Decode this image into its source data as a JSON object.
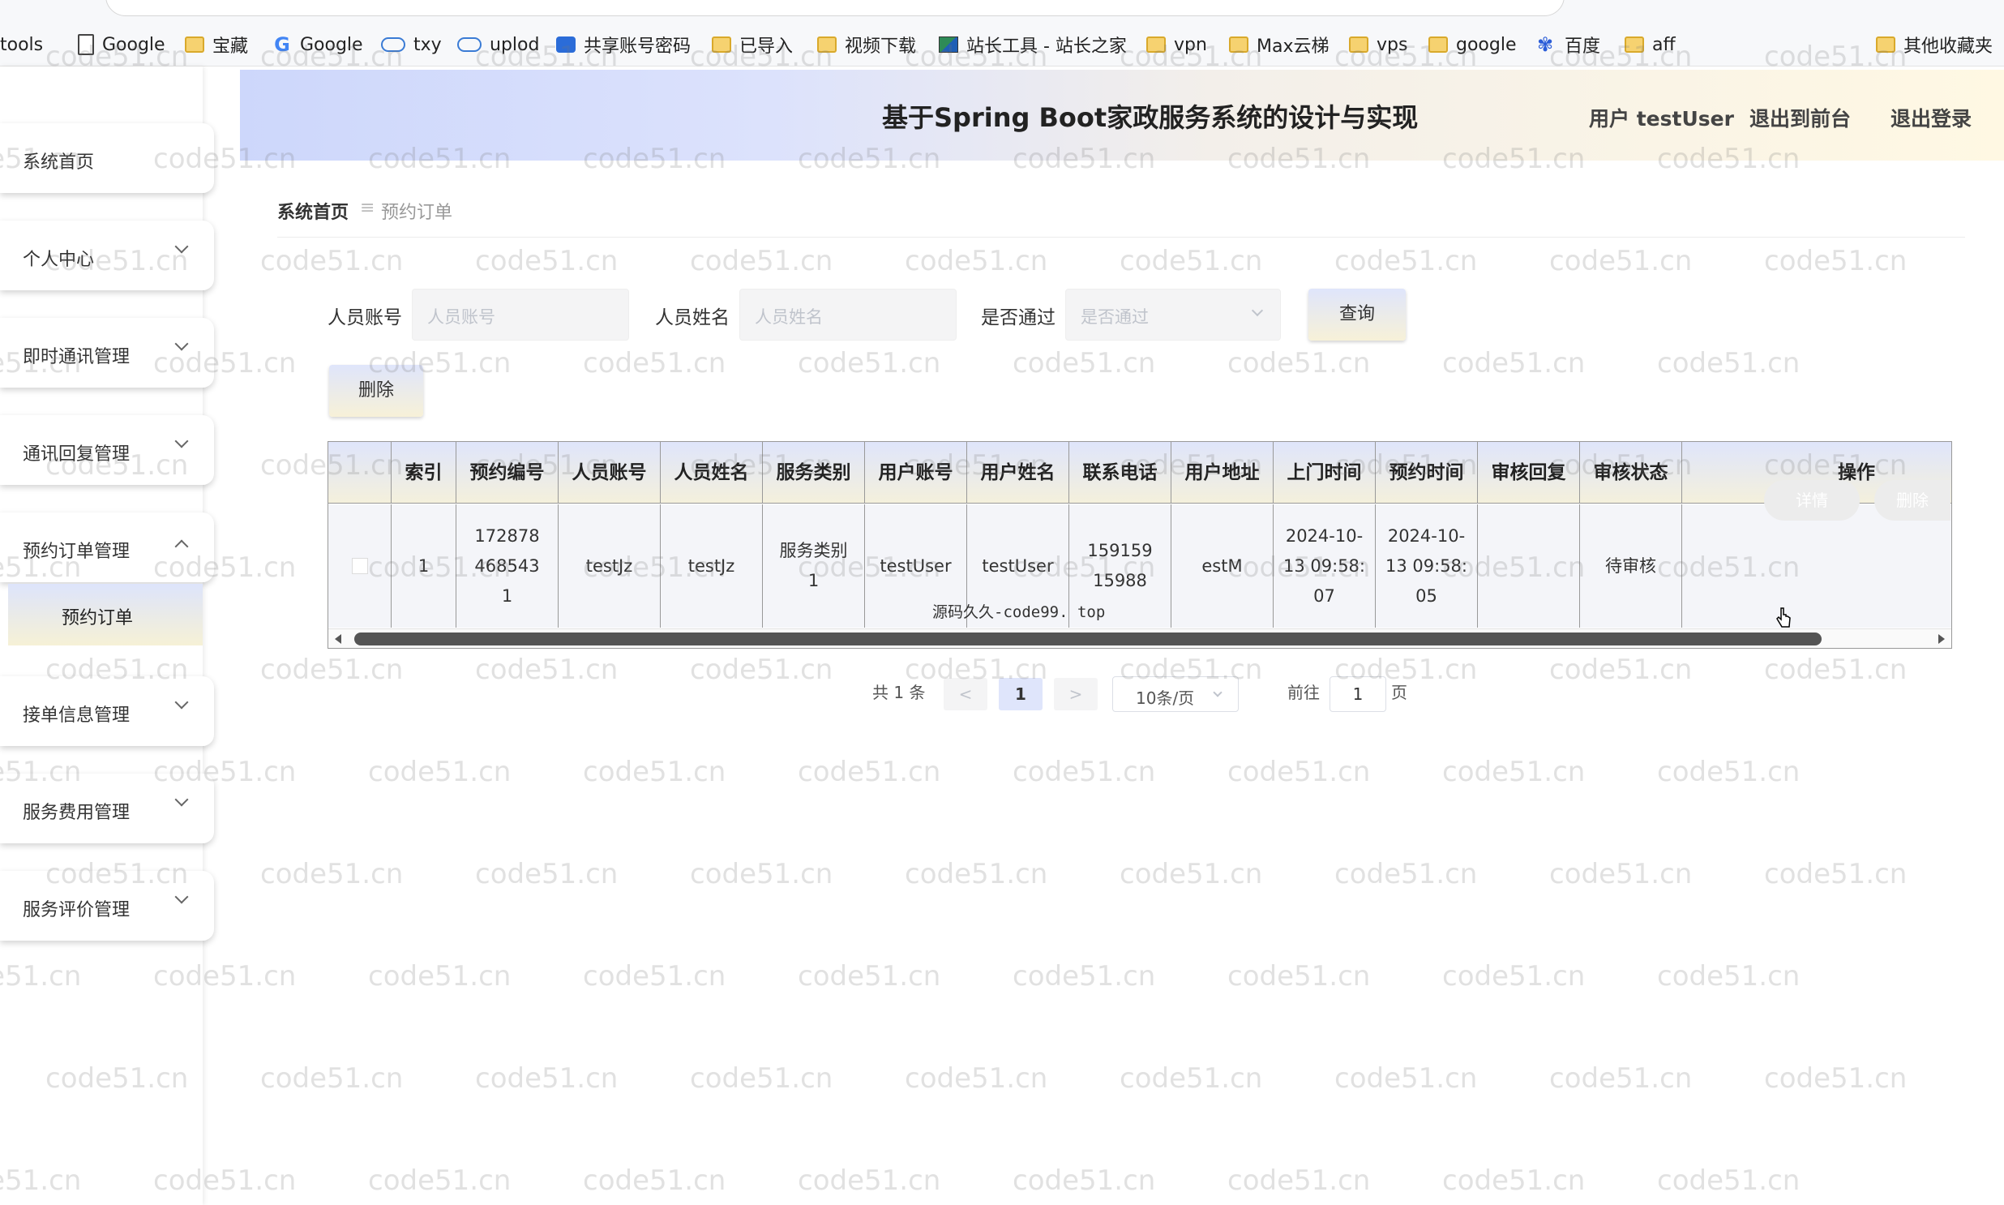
{
  "bookmarks": [
    {
      "label": "tools",
      "icon": "tools-icon"
    },
    {
      "label": "Google",
      "icon": "doc-icon"
    },
    {
      "label": "宝藏",
      "icon": "folder-icon"
    },
    {
      "label": "Google",
      "icon": "google-icon"
    },
    {
      "label": "txy",
      "icon": "cloud-icon"
    },
    {
      "label": "uplod",
      "icon": "cloud-icon"
    },
    {
      "label": "共享账号密码",
      "icon": "app-icon"
    },
    {
      "label": "已导入",
      "icon": "folder-icon"
    },
    {
      "label": "视频下载",
      "icon": "folder-icon"
    },
    {
      "label": "站长工具 - 站长之家",
      "icon": "tool-site-icon"
    },
    {
      "label": "vpn",
      "icon": "folder-icon"
    },
    {
      "label": "Max云梯",
      "icon": "folder-icon"
    },
    {
      "label": "vps",
      "icon": "folder-icon"
    },
    {
      "label": "google",
      "icon": "folder-icon"
    },
    {
      "label": "百度",
      "icon": "baidu-icon"
    },
    {
      "label": "aff",
      "icon": "folder-icon"
    },
    {
      "label": "其他收藏夹",
      "icon": "folder-icon"
    }
  ],
  "sidebar": {
    "items": [
      {
        "label": "系统首页",
        "expanded": false
      },
      {
        "label": "个人中心",
        "expanded": false
      },
      {
        "label": "即时通讯管理",
        "expanded": false
      },
      {
        "label": "通讯回复管理",
        "expanded": false
      },
      {
        "label": "预约订单管理",
        "expanded": true
      },
      {
        "label": "接单信息管理",
        "expanded": false
      },
      {
        "label": "服务费用管理",
        "expanded": false
      },
      {
        "label": "服务评价管理",
        "expanded": false
      }
    ],
    "submenu_active": "预约订单"
  },
  "header": {
    "title": "基于Spring Boot家政服务系统的设计与实现",
    "user_label": "用户 testUser",
    "to_front": "退出到前台",
    "logout": "退出登录"
  },
  "breadcrumb": {
    "home": "系统首页",
    "sep": "≡",
    "current": "预约订单"
  },
  "search": {
    "account_label": "人员账号",
    "account_placeholder": "人员账号",
    "name_label": "人员姓名",
    "name_placeholder": "人员姓名",
    "pass_label": "是否通过",
    "pass_placeholder": "是否通过",
    "query_button": "查询",
    "delete_button": "删除"
  },
  "table": {
    "columns": [
      "索引",
      "预约编号",
      "人员账号",
      "人员姓名",
      "服务类别",
      "用户账号",
      "用户姓名",
      "联系电话",
      "用户地址",
      "上门时间",
      "预约时间",
      "审核回复",
      "审核状态",
      "操作"
    ],
    "rows": [
      {
        "index": "1",
        "order_no": "1728784685431",
        "staff_account": "testJz",
        "staff_name": "testJz",
        "service_type": "服务类别1",
        "user_account": "testUser",
        "user_name": "testUser",
        "phone": "15915915988",
        "address": "estM",
        "visit_time": "2024-10-13 09:58:07",
        "order_time": "2024-10-13 09:58:05",
        "reply": "",
        "status": "待审核",
        "detail_button": "详情",
        "delete_button": "删除"
      }
    ],
    "overlay_text": "源码久久-code99. top"
  },
  "pagination": {
    "total": "共 1 条",
    "prev": "<",
    "current": "1",
    "next": ">",
    "page_size": "10条/页",
    "goto_label": "前往",
    "goto_value": "1",
    "page_suffix": "页"
  },
  "watermark": "code51.cn",
  "colors": {
    "header_left": "#cdd7fb",
    "header_right": "#fff8e3",
    "button_gradient_top": "#dfe5fb",
    "button_gradient_bottom": "#f7f1d8"
  }
}
